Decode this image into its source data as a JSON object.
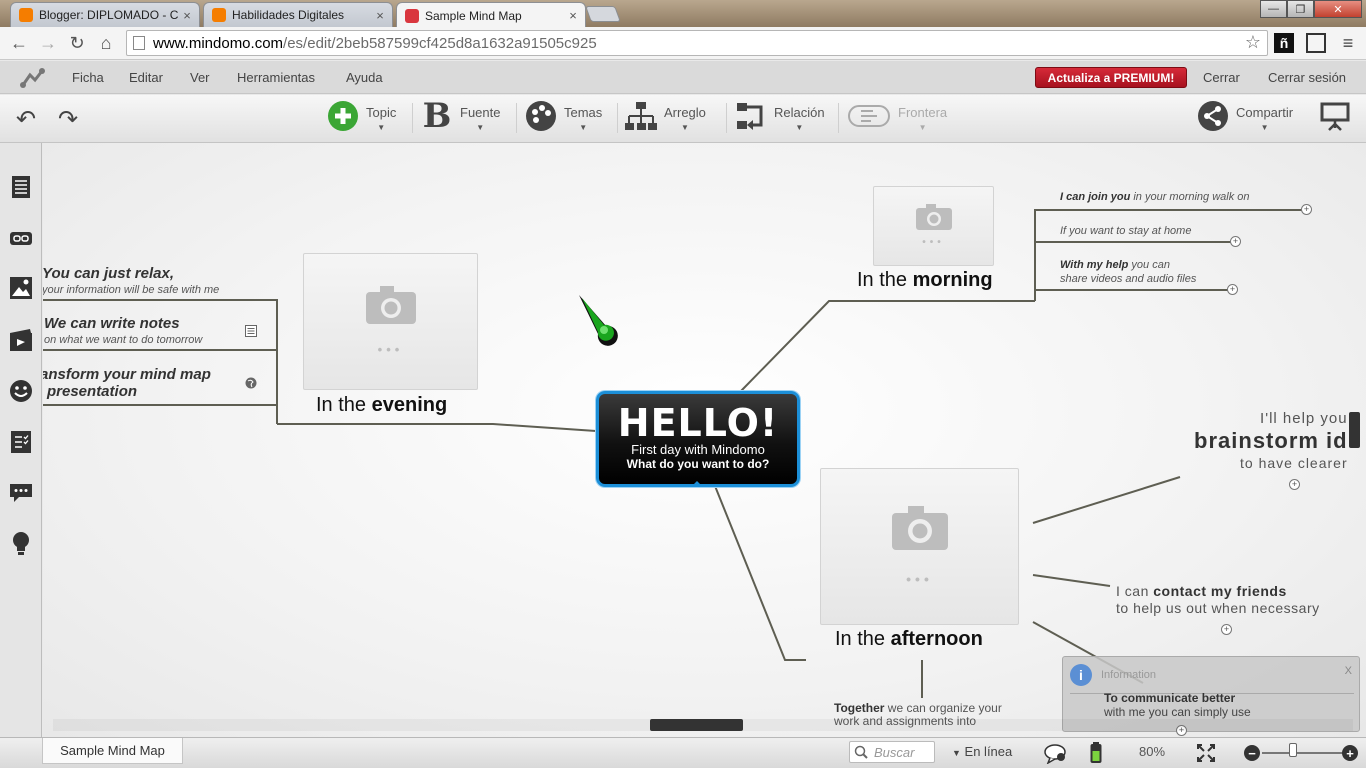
{
  "browser": {
    "tabs": [
      {
        "label": "Blogger: DIPLOMADO - C(",
        "close": "×",
        "active": false
      },
      {
        "label": "Habilidades Digitales",
        "close": "×",
        "active": false
      },
      {
        "label": "Sample Mind Map",
        "close": "×",
        "active": true
      }
    ],
    "window_controls": {
      "minimize": "—",
      "maximize": "❐",
      "close": "✕"
    },
    "url_host": "www.mindomo.com",
    "url_path": "/es/edit/2beb587599cf425d8a1632a91505c925",
    "extensions": {
      "ext1": "ñ"
    }
  },
  "menubar": {
    "items": [
      "Ficha",
      "Editar",
      "Ver",
      "Herramientas",
      "Ayuda"
    ],
    "premium_label": "Actualiza a PREMIUM!",
    "close_label": "Cerrar",
    "logout_label": "Cerrar sesión"
  },
  "ribbon": {
    "topic": "Topic",
    "font": "Fuente",
    "themes": "Temas",
    "layout": "Arreglo",
    "relation": "Relación",
    "boundary": "Frontera",
    "share": "Compartir"
  },
  "mindmap": {
    "central": {
      "title": "HELLO!",
      "line1": "First day with Mindomo",
      "line2": "What do you want to do?"
    },
    "morning": {
      "title_pre": "In the ",
      "title_bold": "morning",
      "leaves": [
        {
          "bold": "I can join you",
          "rest": " in your morning walk on"
        },
        {
          "bold": "",
          "rest": "If you want to stay at home"
        },
        {
          "bold": "With my help",
          "rest": " you can",
          "line2": "share videos and audio files"
        }
      ]
    },
    "evening": {
      "title_pre": "In the ",
      "title_bold": "evening",
      "leaves": [
        {
          "line1": "You can just relax,",
          "line2": "your information will be safe with me"
        },
        {
          "line1": "We can write notes",
          "line2": "on what we want to do tomorrow"
        },
        {
          "line1": "ansform your mind map",
          "line2": "presentation"
        }
      ]
    },
    "afternoon": {
      "title_pre": "In the ",
      "title_bold": "afternoon",
      "brainstorm": {
        "line1": "I'll help you",
        "line2": "brainstorm id",
        "line3": "to have clearer"
      },
      "friends": {
        "pre": "I can ",
        "bold": "contact my friends",
        "line2": "to help us out when necessary"
      },
      "communicate": {
        "bold": "To communicate better",
        "line2": "with me you can simply use"
      },
      "together": {
        "bold": "Together",
        "rest": " we can organize your",
        "line2": "work and assignments into"
      }
    },
    "info_panel": {
      "title": "Information",
      "close": "X"
    },
    "photo_dots": "•••"
  },
  "statusbar": {
    "sheet_tab": "Sample Mind Map",
    "search_placeholder": "Buscar",
    "online": "En línea",
    "zoom": "80%",
    "zoom_minus": "−",
    "zoom_plus": "+"
  }
}
